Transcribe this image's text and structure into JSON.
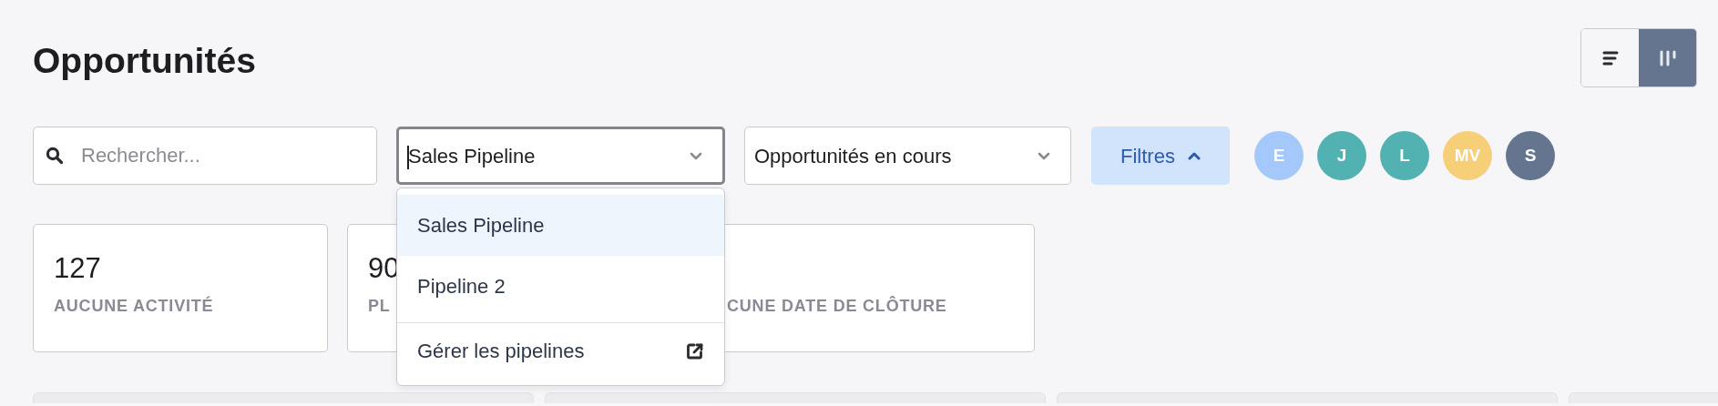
{
  "title": "Opportunités",
  "view_toggle": [
    {
      "kind": "list",
      "selected": false
    },
    {
      "kind": "board",
      "selected": true
    }
  ],
  "search": {
    "placeholder": "Rechercher..."
  },
  "pipeline_select": {
    "value": "Sales Pipeline",
    "focused": true,
    "expanded": true
  },
  "pipeline_menu": [
    {
      "kind": "option",
      "label": "Sales Pipeline",
      "selected": true
    },
    {
      "kind": "option",
      "label": "Pipeline 2",
      "selected": false
    },
    {
      "kind": "link",
      "label": "Gérer les pipelines",
      "selected": false
    }
  ],
  "status_select": {
    "value": "Opportunités en cours"
  },
  "filters_button": {
    "label": "Filtres",
    "expanded": true
  },
  "owners": [
    {
      "initials": "E",
      "color": "#a5c8fb"
    },
    {
      "initials": "J",
      "color": "#52b1b1"
    },
    {
      "initials": "L",
      "color": "#52b1b1"
    },
    {
      "initials": "MV",
      "color": "#f7cf79"
    },
    {
      "initials": "S",
      "color": "#66758f"
    }
  ],
  "stat_cards": [
    {
      "value": "127",
      "label": "AUCUNE ACTIVITÉ"
    },
    {
      "value": "90",
      "label": "PL"
    },
    {
      "label": "CUNE DATE DE CLÔTURE"
    }
  ],
  "board_columns": [
    {
      "kind": "column"
    },
    {
      "kind": "column"
    },
    {
      "kind": "column"
    },
    {
      "kind": "column"
    }
  ]
}
